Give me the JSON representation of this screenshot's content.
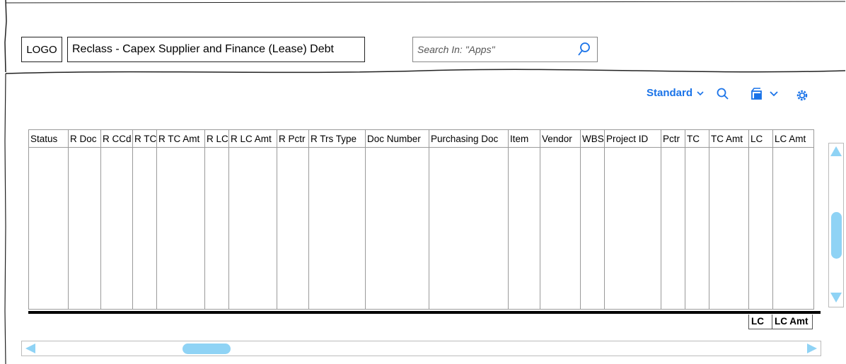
{
  "header": {
    "logo_label": "LOGO",
    "app_title": "Reclass - Capex Supplier and Finance (Lease) Debt",
    "search_placeholder": "Search In: \"Apps\""
  },
  "toolbar": {
    "variant_label": "Standard",
    "icons": [
      "search-icon",
      "export-icon",
      "chevron-down-icon",
      "settings-icon"
    ]
  },
  "table": {
    "columns": [
      "Status",
      "R Doc",
      "R CCd",
      "R TC",
      "R TC Amt",
      "R LC",
      "R LC Amt",
      "R Pctr",
      "R Trs Type",
      "Doc Number",
      "Purchasing Doc",
      "Item",
      "Vendor",
      "WBS",
      "Project ID",
      "Pctr",
      "TC",
      "TC Amt",
      "LC",
      "LC Amt"
    ],
    "rows": [],
    "totals": {
      "lc": "LC",
      "lc_amt": "LC Amt"
    }
  },
  "scrollbars": {
    "vertical_position": 0.62,
    "horizontal_position": 0.2
  },
  "colors": {
    "accent": "#1a73e8",
    "scroll": "#8fd3f5"
  }
}
